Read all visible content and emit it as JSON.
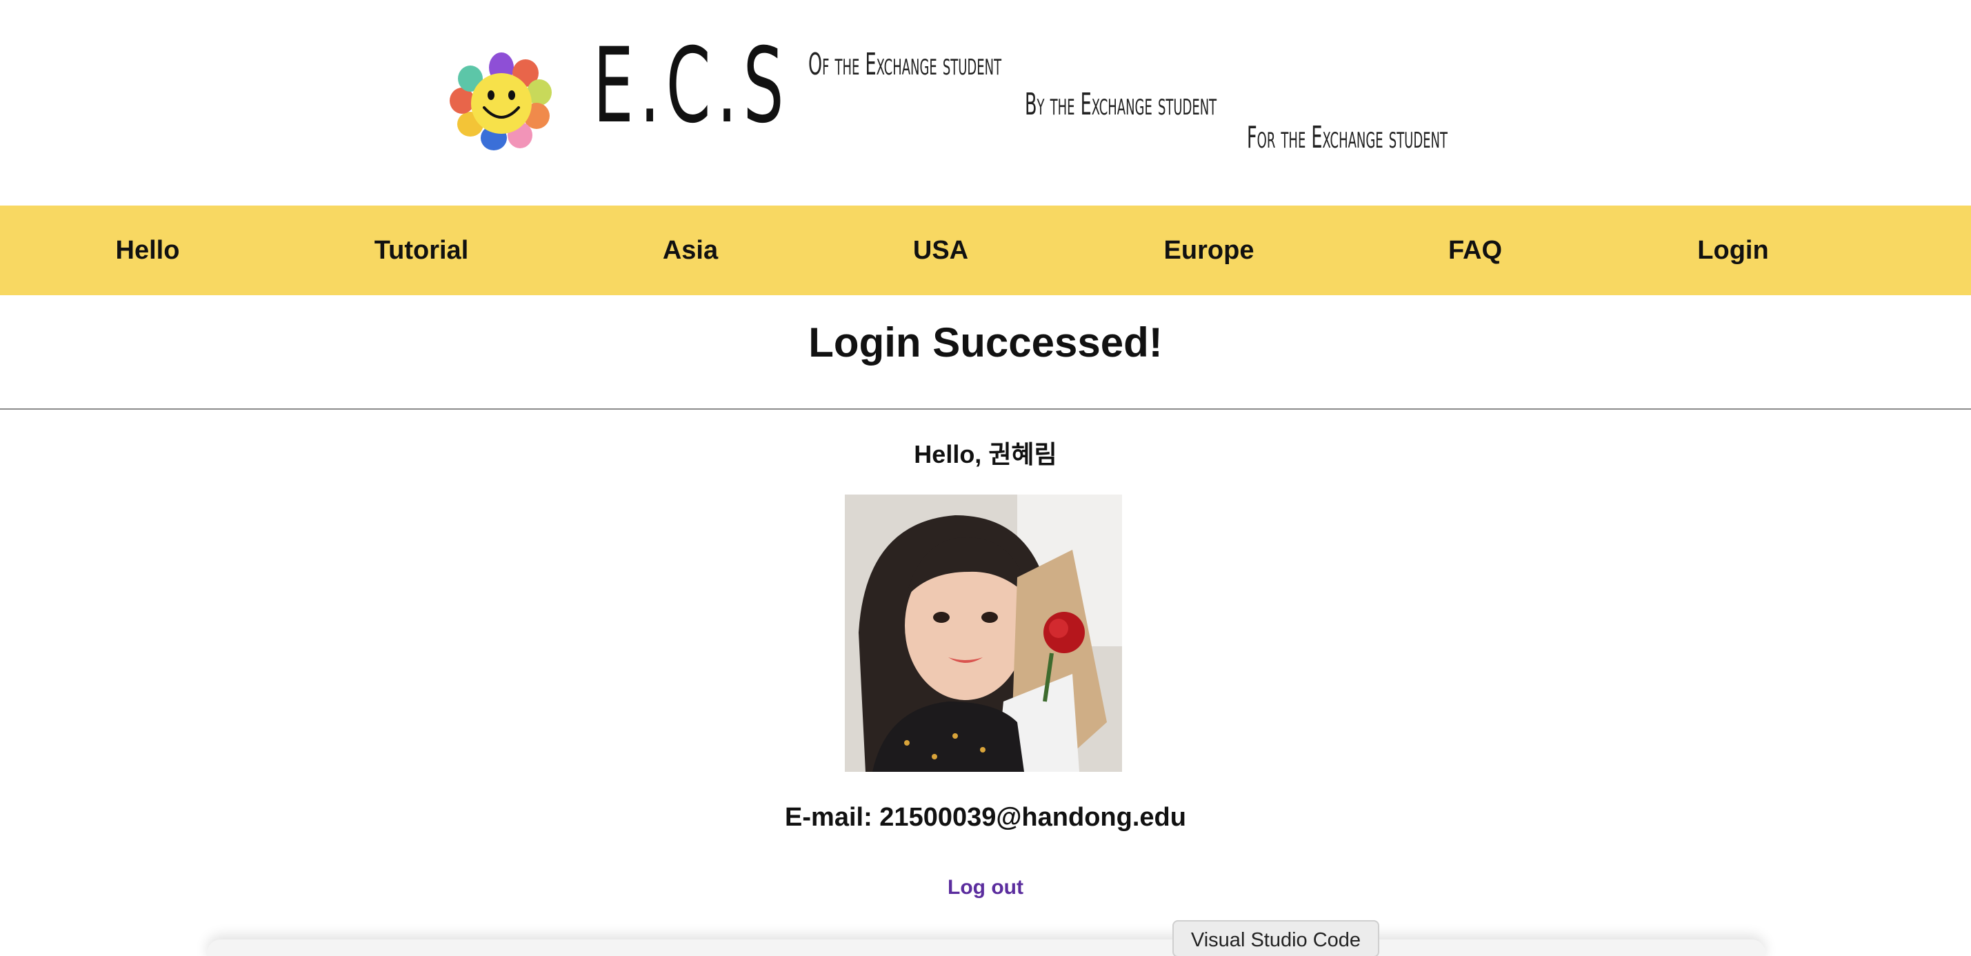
{
  "header": {
    "logo_text": "E.C.S",
    "taglines": [
      "Of the Exchange student",
      "By the Exchange student",
      "For the Exchange student"
    ]
  },
  "nav": {
    "items": [
      {
        "label": "Hello"
      },
      {
        "label": "Tutorial"
      },
      {
        "label": "Asia"
      },
      {
        "label": "USA"
      },
      {
        "label": "Europe"
      },
      {
        "label": "FAQ"
      },
      {
        "label": "Login"
      }
    ],
    "background_color": "#f8d862"
  },
  "main": {
    "title": "Login Successed!",
    "greeting": "Hello, 권혜림",
    "email": "E-mail: 21500039@handong.edu",
    "logout_label": "Log out",
    "logout_color": "#5b2d9e"
  },
  "tooltip": {
    "text": "Visual Studio Code"
  }
}
